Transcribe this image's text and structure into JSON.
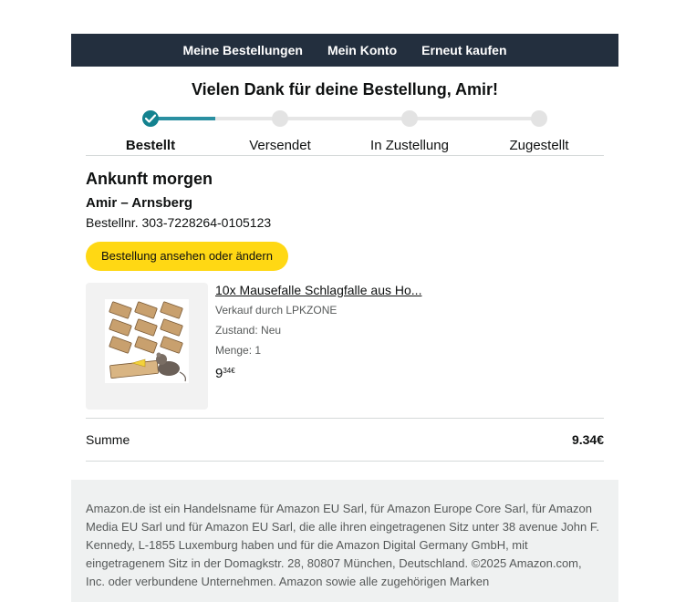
{
  "nav": {
    "orders": "Meine Bestellungen",
    "account": "Mein Konto",
    "buy_again": "Erneut kaufen"
  },
  "headline": "Vielen Dank für deine Bestellung, Amir!",
  "steps": [
    {
      "label": "Bestellt",
      "done": true
    },
    {
      "label": "Versendet",
      "done": false
    },
    {
      "label": "In Zustellung",
      "done": false
    },
    {
      "label": "Zugestellt",
      "done": false
    }
  ],
  "shipment": {
    "arrival": "Ankunft morgen",
    "recipient": "Amir – Arnsberg",
    "order_number": "Bestellnr. 303-7228264-0105123",
    "button_label": "Bestellung ansehen oder ändern"
  },
  "product": {
    "title": "10x Mausefalle Schlagfalle aus Ho...",
    "seller": "Verkauf durch LPKZONE",
    "condition": "Zustand: Neu",
    "quantity": "Menge: 1",
    "price_main": "9",
    "price_fraction": "34€"
  },
  "summary": {
    "label": "Summe",
    "amount": "9.34€"
  },
  "footer": {
    "text": "Amazon.de ist ein Handelsname für Amazon EU Sarl, für Amazon Europe Core Sarl, für Amazon Media EU Sarl und für Amazon EU Sarl, die alle ihren eingetragenen Sitz unter 38 avenue John F. Kennedy, L-1855 Luxemburg haben und für die Amazon Digital Germany GmbH, mit eingetragenem Sitz in der Domagkstr. 28, 80807 München, Deutschland. ©2025 Amazon.com, Inc. oder verbundene Unternehmen. Amazon sowie alle zugehörigen Marken"
  },
  "colors": {
    "nav_bg": "#232f3e",
    "progress": "#2a8fa1",
    "button": "#ffd814",
    "footer_bg": "#eff1f1"
  }
}
